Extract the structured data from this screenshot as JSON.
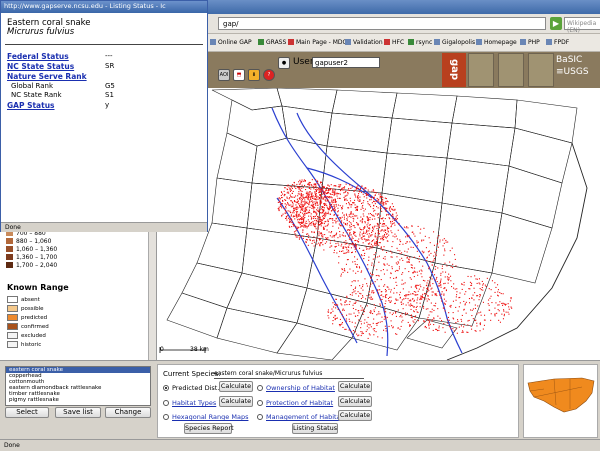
{
  "browser": {
    "url": "gap/",
    "search_placeholder": "Wikipedia (EN)",
    "status": "Done",
    "bookmarks": [
      "Online GAP",
      "GRASS",
      "Main Page - MDC",
      "Validation",
      "HFC",
      "rsync",
      "Gigalopolis",
      "Homepage",
      "PHP",
      "FPDF"
    ]
  },
  "gap_header": {
    "toolbar_icons": [
      "AOI"
    ],
    "user_label": "User:",
    "user_value": "gapuser2",
    "logo_text": "gap",
    "basic_line1": "BaSIC",
    "basic_line2": "≡USGS"
  },
  "popup": {
    "title": "http://www.gapserve.ncsu.edu - Listing Status - Ic",
    "common_name": "Eastern coral snake",
    "scientific_name": "Micrurus fulvius",
    "rows": [
      {
        "label": "Federal Status",
        "value": "---",
        "kind": "h"
      },
      {
        "label": "NC State Status",
        "value": "SR",
        "kind": "h"
      },
      {
        "label": "Nature Serve Rank",
        "value": "",
        "kind": "h"
      },
      {
        "label": "Global Rank",
        "value": "G5",
        "kind": "sub"
      },
      {
        "label": "NC State Rank",
        "value": "S1",
        "kind": "sub"
      },
      {
        "label": "GAP Status",
        "value": "y",
        "kind": "h"
      }
    ],
    "status": "Done"
  },
  "legend": {
    "elevation": [
      {
        "label": "700 – 880",
        "color": "#c98a5a"
      },
      {
        "label": "880 – 1,060",
        "color": "#b2683a"
      },
      {
        "label": "1,060 – 1,360",
        "color": "#99502a"
      },
      {
        "label": "1,360 – 1,700",
        "color": "#7e3c1e"
      },
      {
        "label": "1,700 – 2,040",
        "color": "#5e2a12"
      }
    ],
    "known_range_title": "Known Range",
    "known_range": [
      {
        "label": "absent",
        "color": "#ffffff"
      },
      {
        "label": "possible",
        "color": "#f5c98c"
      },
      {
        "label": "predicted",
        "color": "#ee8a2e"
      },
      {
        "label": "confirmed",
        "color": "#a8521c"
      },
      {
        "label": "excluded",
        "color": "#f4f4f4"
      },
      {
        "label": "historic",
        "color": "#f4f4f4"
      }
    ]
  },
  "map": {
    "scale_start": "0",
    "scale_end": "38 km",
    "accent_red": "#ee1111"
  },
  "species_list": {
    "items": [
      "eastern coral snake",
      "copperhead",
      "cottonmouth",
      "eastern diamondback rattlesnake",
      "timber rattlesnake",
      "pigmy rattlesnake"
    ],
    "selected_index": 0,
    "select_label": "Select",
    "save_label": "Save list",
    "change_label": "Change"
  },
  "calc": {
    "current_label": "Current Species:",
    "current_value": "eastern coral snake/Micrurus fulvius",
    "opt_predicted": "Predicted Dist.",
    "opt_habitat_types": "Habitat Types",
    "opt_hex": "Hexagonal Range Maps",
    "opt_ownership": "Ownership of Habitat",
    "opt_protection": "Protection of Habitat",
    "opt_management": "Management of Habitat",
    "calculate": "Calculate",
    "species_report": "Species Report",
    "listing_status": "Listing Status"
  }
}
